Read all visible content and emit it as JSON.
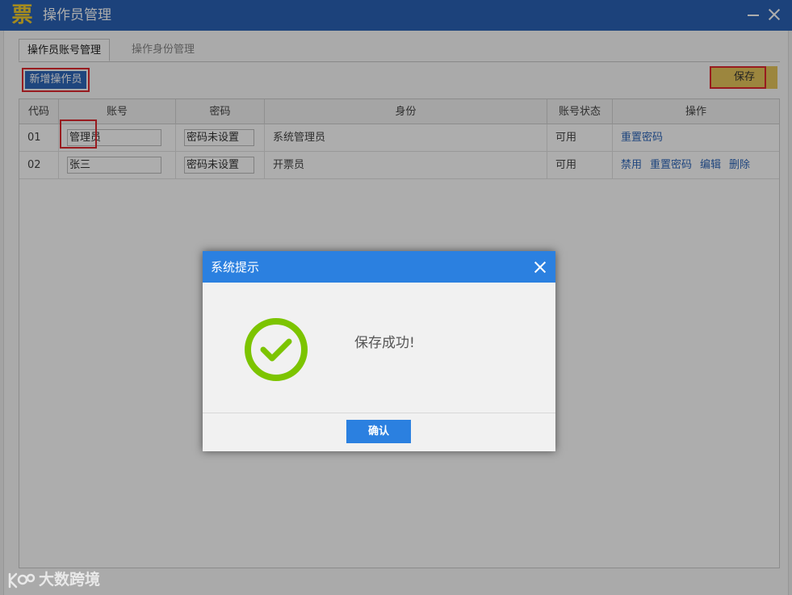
{
  "window": {
    "logo_char": "票",
    "title": "操作员管理"
  },
  "tabs": [
    {
      "label": "操作员账号管理",
      "active": true
    },
    {
      "label": "操作身份管理",
      "active": false
    }
  ],
  "toolbar": {
    "add_label": "新增操作员",
    "save_label": "保存"
  },
  "table": {
    "headers": [
      "代码",
      "账号",
      "密码",
      "身份",
      "账号状态",
      "操作"
    ],
    "rows": [
      {
        "code": "01",
        "account": "管理员",
        "password": "密码未设置",
        "role": "系统管理员",
        "status": "可用",
        "actions": [
          "重置密码"
        ]
      },
      {
        "code": "02",
        "account": "张三",
        "password": "密码未设置",
        "role": "开票员",
        "status": "可用",
        "actions": [
          "禁用",
          "重置密码",
          "编辑",
          "删除"
        ]
      }
    ]
  },
  "dialog": {
    "title": "系统提示",
    "message": "保存成功!",
    "ok_label": "确认",
    "icon": "check-circle-icon",
    "icon_color": "#7cc400"
  },
  "watermark": {
    "text": "大数跨境"
  },
  "colors": {
    "titlebar": "#2a62b6",
    "accent": "#2b80e0",
    "save": "#e6c65c",
    "highlight": "#e0282f"
  }
}
